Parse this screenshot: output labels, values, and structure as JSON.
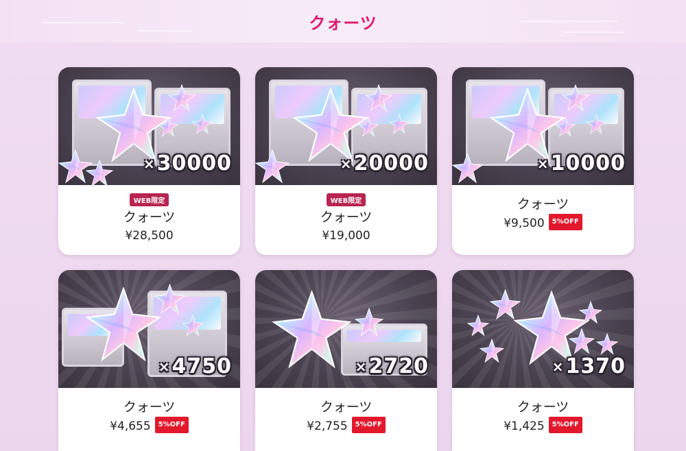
{
  "section": {
    "title": "クォーツ"
  },
  "colors": {
    "accent": "#e0186e",
    "web_badge": "#b8244f",
    "off_badge": "#e2182c",
    "card_art_bg": "#4a4250"
  },
  "products": [
    {
      "art_count": "30000",
      "name": "クォーツ",
      "price": "¥28,500",
      "web_label": "WEB限定",
      "off_label": "",
      "icon": "quartz-star-chest-icon"
    },
    {
      "art_count": "20000",
      "name": "クォーツ",
      "price": "¥19,000",
      "web_label": "WEB限定",
      "off_label": "",
      "icon": "quartz-star-chest-icon"
    },
    {
      "art_count": "10000",
      "name": "クォーツ",
      "price": "¥9,500",
      "web_label": "",
      "off_label": "5%OFF",
      "icon": "quartz-star-chest-icon"
    },
    {
      "art_count": "4750",
      "name": "クォーツ",
      "price": "¥4,655",
      "web_label": "",
      "off_label": "5%OFF",
      "icon": "quartz-star-chest-icon"
    },
    {
      "art_count": "2720",
      "name": "クォーツ",
      "price": "¥2,755",
      "web_label": "",
      "off_label": "5%OFF",
      "icon": "quartz-star-box-icon"
    },
    {
      "art_count": "1370",
      "name": "クォーツ",
      "price": "¥1,425",
      "web_label": "",
      "off_label": "5%OFF",
      "icon": "quartz-star-cluster-icon"
    }
  ],
  "multiplier_symbol": "×"
}
